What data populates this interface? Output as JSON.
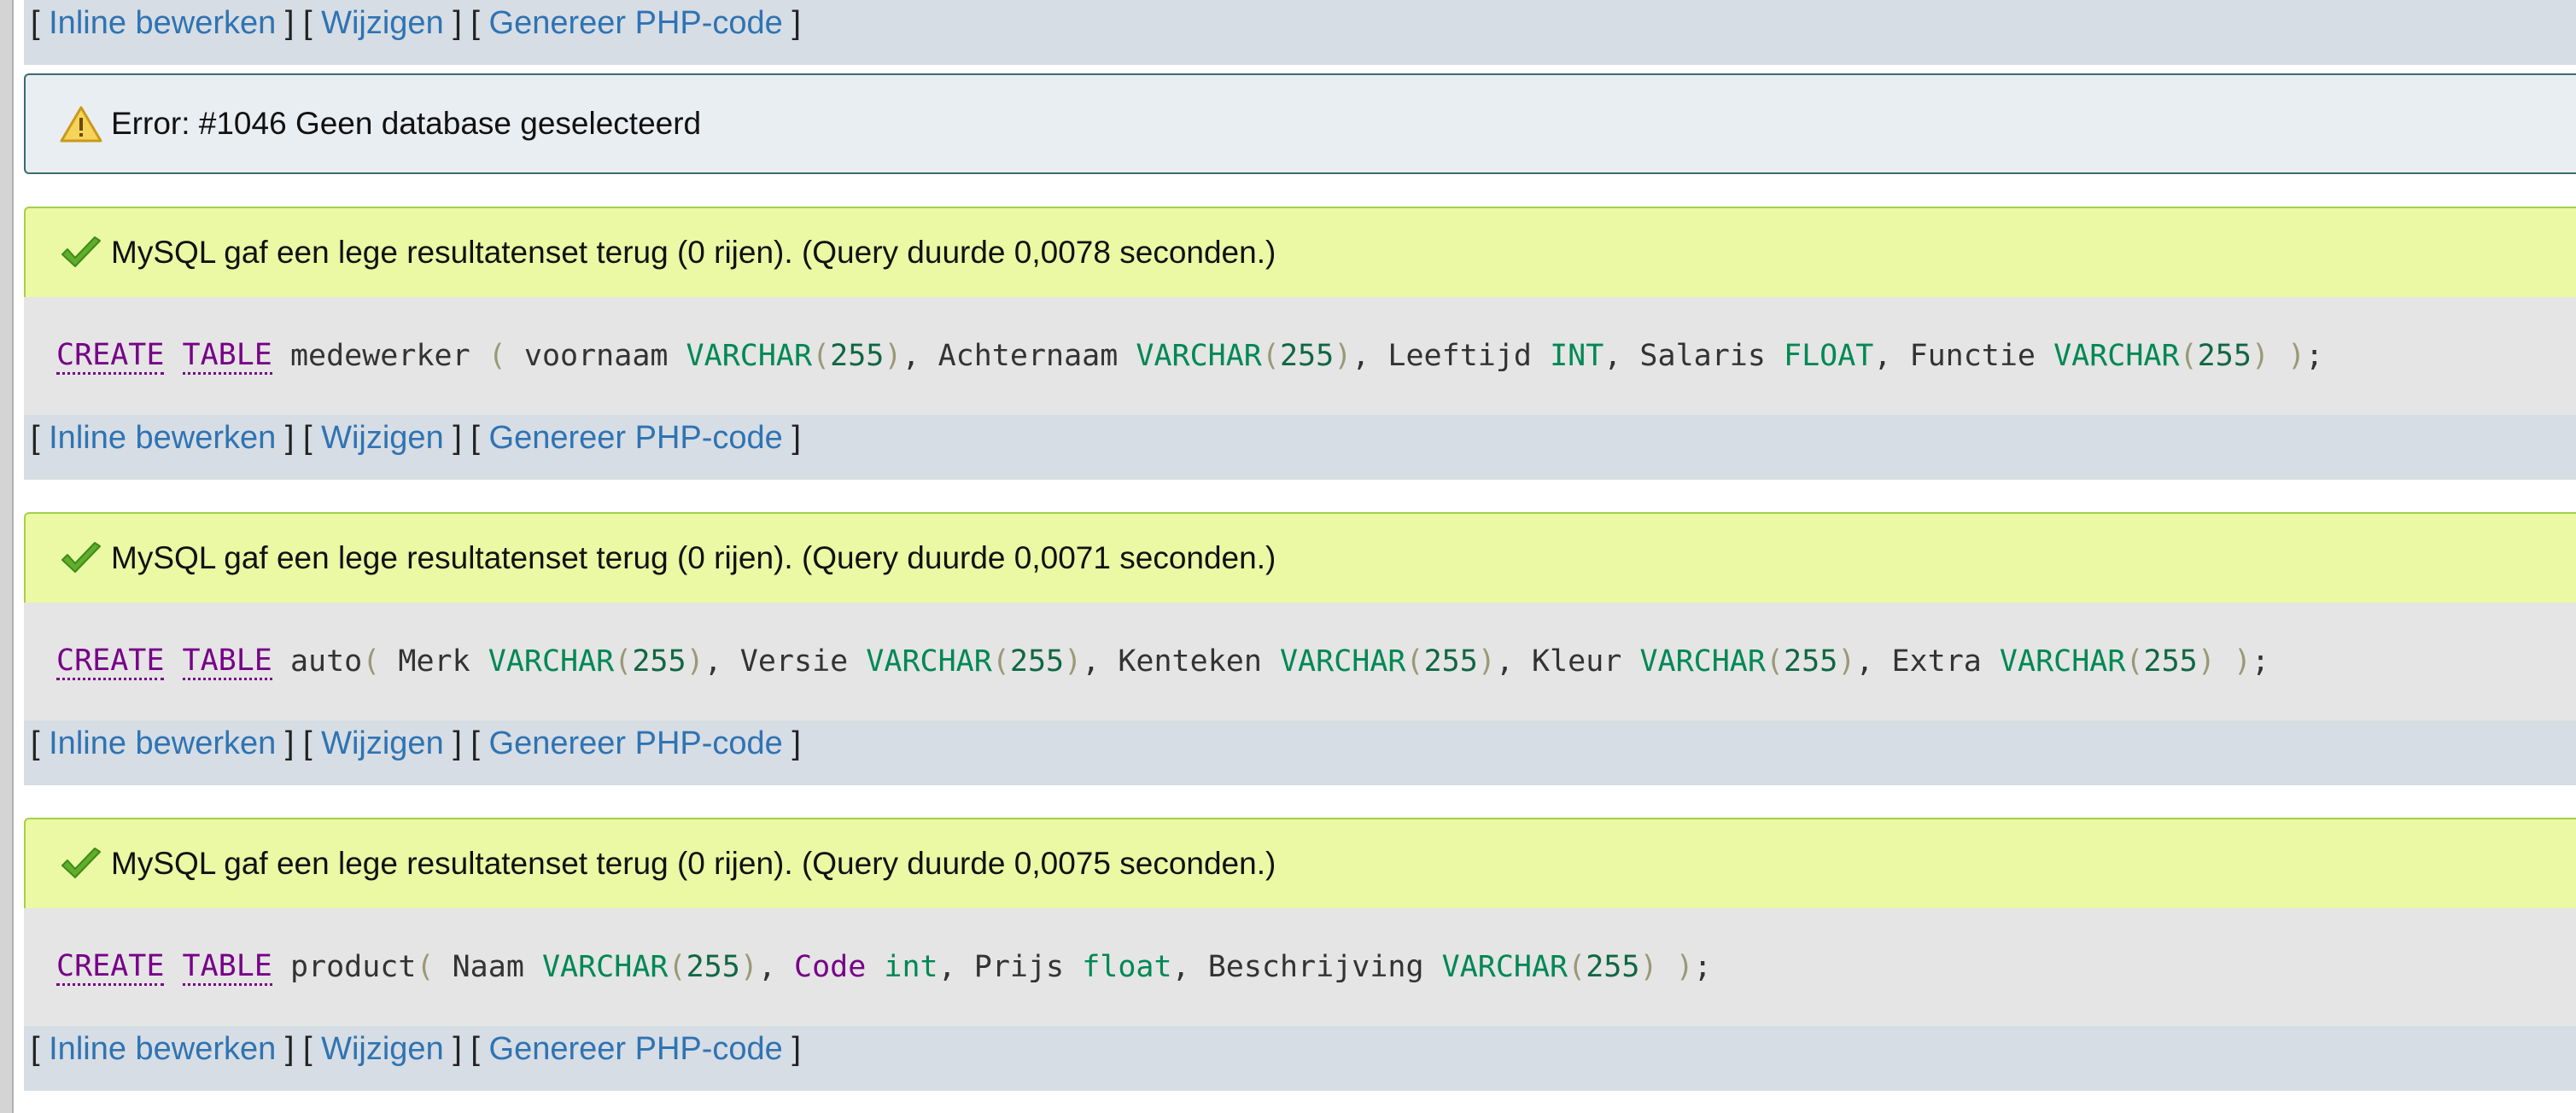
{
  "links": {
    "open": "[",
    "close": "]",
    "sep": "] [",
    "inline_edit": "Inline bewerken",
    "edit": "Wijzigen",
    "php": "Genereer PHP-code"
  },
  "error": {
    "message": "Error: #1046 Geen database geselecteerd"
  },
  "results": [
    {
      "message": "MySQL gaf een lege resultatenset terug (0 rijen). (Query duurde 0,0078 seconden.)",
      "sql": "CREATE TABLE medewerker ( voornaam VARCHAR(255), Achternaam VARCHAR(255), Leeftijd INT, Salaris FLOAT, Functie VARCHAR(255) );"
    },
    {
      "message": "MySQL gaf een lege resultatenset terug (0 rijen). (Query duurde 0,0071 seconden.)",
      "sql": "CREATE TABLE auto( Merk VARCHAR(255), Versie VARCHAR(255), Kenteken VARCHAR(255), Kleur VARCHAR(255), Extra VARCHAR(255) );"
    },
    {
      "message": "MySQL gaf een lege resultatenset terug (0 rijen). (Query duurde 0,0075 seconden.)",
      "sql": "CREATE TABLE product( Naam VARCHAR(255), Code int, Prijs float, Beschrijving VARCHAR(255) );"
    }
  ],
  "colors": {
    "link": "#2f73b3",
    "success_bg": "#ebf8a4",
    "error_bg": "#e9eef2",
    "keyword": "#770088",
    "type": "#008855"
  }
}
